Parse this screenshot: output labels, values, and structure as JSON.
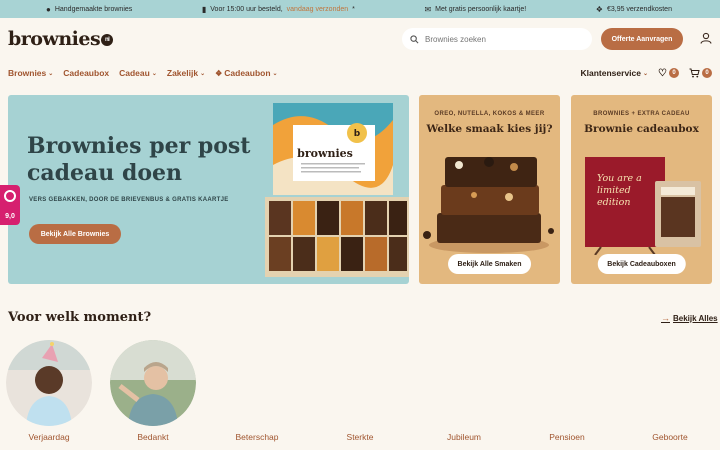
{
  "topbar": {
    "item1": "Handgemaakte brownies",
    "item2_prefix": "Voor 15:00 uur besteld,",
    "item2_accent": "vandaag verzonden",
    "item2_suffix": "*",
    "item3": "Met gratis persoonlijk kaartje!",
    "item4": "€3,95 verzendkosten"
  },
  "header": {
    "logo_text": "brownies",
    "logo_badge": "nl",
    "search_placeholder": "Brownies zoeken",
    "offerte_label": "Offerte Aanvragen"
  },
  "nav": {
    "items": [
      {
        "label": "Brownies",
        "has_dropdown": true
      },
      {
        "label": "Cadeaubox",
        "has_dropdown": false
      },
      {
        "label": "Cadeau",
        "has_dropdown": true
      },
      {
        "label": "Zakelijk",
        "has_dropdown": true
      },
      {
        "label": "Cadeaubon",
        "has_dropdown": true
      }
    ],
    "klantenservice": "Klantenservice",
    "wishlist_count": "0",
    "cart_count": "0"
  },
  "hero": {
    "title": "Brownies per post cadeau doen",
    "subtitle": "VERS GEBAKKEN, DOOR DE BRIEVENBUS & GRATIS KAARTJE",
    "button": "Bekijk Alle Brownies",
    "box_label": "brownies"
  },
  "cards": [
    {
      "kicker": "OREO, NUTELLA, KOKOS & MEER",
      "title": "Welke smaak kies jij?",
      "button": "Bekijk Alle Smaken"
    },
    {
      "kicker": "BROWNIES + EXTRA CADEAU",
      "title": "Brownie cadeaubox",
      "button": "Bekijk Cadeauboxen",
      "card_text": "You are a limited edition"
    }
  ],
  "moments": {
    "title": "Voor welk moment?",
    "view_all": "Bekijk Alles",
    "items": [
      "Verjaardag",
      "Bedankt",
      "Beterschap",
      "Sterkte",
      "Jubileum",
      "Pensioen",
      "Geboorte"
    ]
  },
  "side_widget": {
    "score": "9,0"
  },
  "colors": {
    "accent": "#b96d44",
    "teal": "#a6d2d3",
    "sand": "#e3b87f",
    "background": "#faf6ef"
  }
}
